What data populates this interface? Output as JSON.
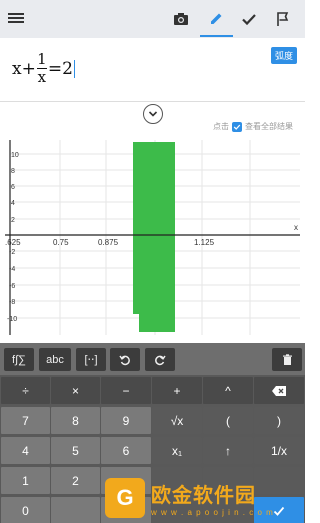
{
  "toolbar": {
    "icons": [
      "menu-icon",
      "camera-icon",
      "pencil-icon",
      "check-icon",
      "flag-icon"
    ],
    "active_tab": "pencil",
    "accent": "#2f8fe5"
  },
  "input": {
    "formula_prefix": "x+",
    "fraction_num": "1",
    "fraction_den": "x",
    "formula_suffix": "=2",
    "mode_badge": "弧度"
  },
  "results": {
    "view_all_prefix": "点击",
    "view_all_label": "查看全部结果"
  },
  "graph": {
    "x_axis_label": "x",
    "x_ticks": [
      ".625",
      "0.75",
      "0.875",
      "1.125"
    ],
    "y_ticks": [
      "10",
      "8",
      "6",
      "4",
      "2",
      "-2",
      "-4",
      "-6",
      "-8",
      "-10"
    ],
    "fill_color": "#3dbb4a"
  },
  "keyboard": {
    "tabs": [
      "f∫∑",
      "abc",
      "[⋅⋅]"
    ],
    "row1": [
      "÷",
      "×",
      "−",
      "+",
      "^"
    ],
    "row2": [
      "7",
      "8",
      "9",
      "√x",
      "(",
      ")"
    ],
    "row3": [
      "4",
      "5",
      "6",
      "x₁",
      "↑",
      "1/x"
    ],
    "row4": [
      "1",
      "2"
    ],
    "row5": [
      "0"
    ]
  },
  "watermark": {
    "logo_char": "G",
    "name": "欧金软件园",
    "url": "w w w . a p o o j i n . c o m"
  }
}
